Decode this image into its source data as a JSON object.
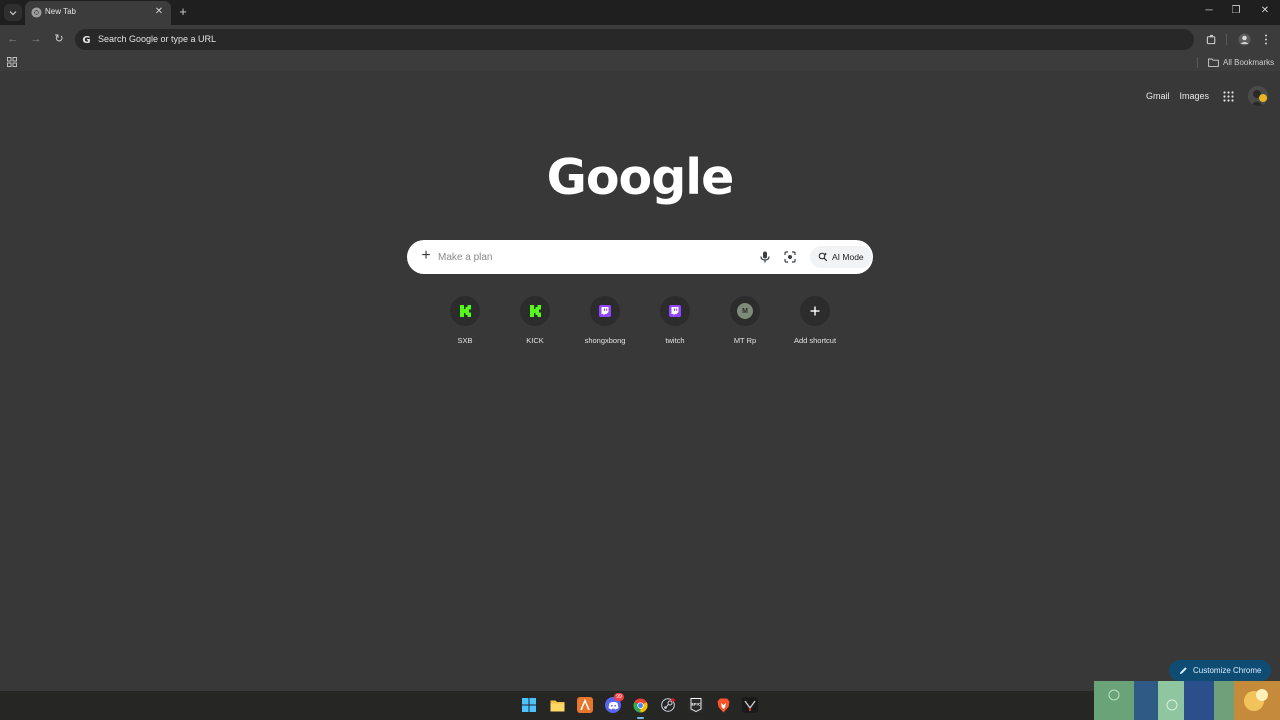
{
  "browser": {
    "tab": {
      "title": "New Tab",
      "favicon": "chrome-icon",
      "close_icon": "close-icon"
    },
    "new_tab_icon": "plus-icon",
    "window_controls": [
      "minimize-icon",
      "restore-icon",
      "close-icon"
    ],
    "omnibox": {
      "placeholder": "Search Google or type a URL"
    },
    "bookmarks_bar": {
      "all_bookmarks_label": "All Bookmarks"
    }
  },
  "ntp": {
    "top_links": {
      "gmail": "Gmail",
      "images": "Images"
    },
    "logo": "Google",
    "search": {
      "placeholder": "Make a plan",
      "ai_mode_label": "AI Mode"
    },
    "shortcuts": [
      {
        "label": "SXB",
        "icon": "kick-icon",
        "color": "#53fc18"
      },
      {
        "label": "KICK",
        "icon": "kick-icon",
        "color": "#53fc18"
      },
      {
        "label": "shongxbong",
        "icon": "twitch-icon",
        "color": "#9146ff"
      },
      {
        "label": "twitch",
        "icon": "twitch-icon",
        "color": "#9146ff"
      },
      {
        "label": "MT Rp",
        "icon": "letter-avatar",
        "letter": "M",
        "color": "#7d8b78"
      },
      {
        "label": "Add shortcut",
        "icon": "plus-icon",
        "color": "#ffffff"
      }
    ],
    "customize_label": "Customize Chrome"
  },
  "taskbar": {
    "apps": [
      "windows-start-icon",
      "file-explorer-icon",
      "app-a-icon",
      "discord-icon",
      "chrome-icon",
      "steam-icon",
      "epic-games-icon",
      "brave-icon",
      "game-launcher-icon"
    ],
    "discord_badge": "99"
  },
  "colors": {
    "page_bg": "#383838",
    "tabstrip_bg": "#1f1f1f",
    "toolbar_bg": "#3c3c3c",
    "kick_green": "#53fc18",
    "twitch_purple": "#9146ff",
    "customize_bg": "#0f4c73"
  }
}
